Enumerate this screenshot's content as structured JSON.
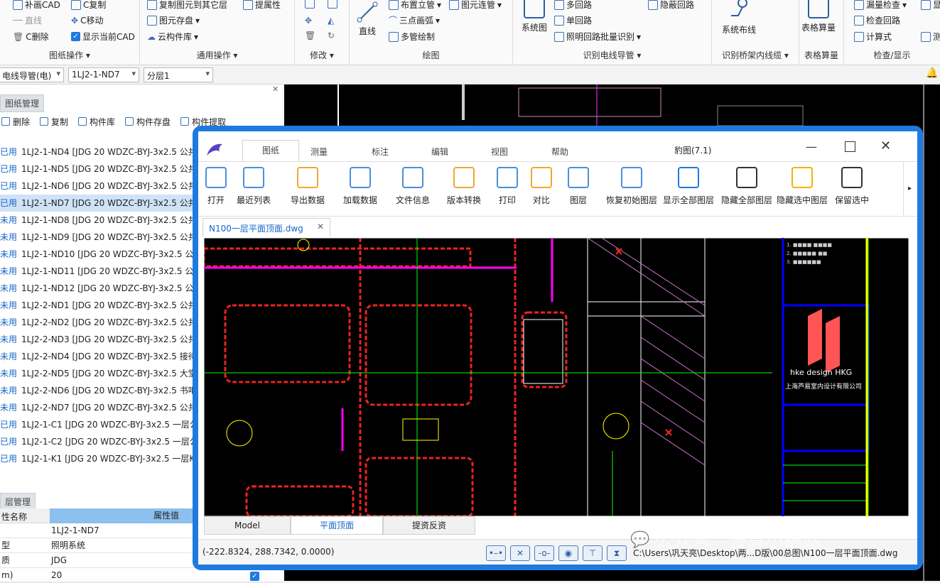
{
  "ribbon": {
    "group1": {
      "label": "图纸操作",
      "items": [
        "补画CAD",
        "C复制",
        "直线",
        "C移动",
        "C删除",
        "显示当前CAD"
      ]
    },
    "group2": {
      "label": "通用操作",
      "items": [
        "复制图元到其它层",
        "提属性",
        "图元存盘",
        "云构件库"
      ]
    },
    "group3": {
      "label": "修改"
    },
    "group4": {
      "label": "绘图",
      "items": [
        "直线",
        "布置立管",
        "图元连管",
        "三点画弧",
        "多管绘制"
      ]
    },
    "group5": {
      "label": "识别电线导管",
      "items": [
        "系统图",
        "多回路",
        "单回路",
        "隐蔽回路",
        "照明回路批量识别"
      ]
    },
    "group6": {
      "label": "识别桥架内线缆",
      "items": [
        "系统布线"
      ]
    },
    "group7": {
      "label": "表格算量",
      "items": [
        "表格算量"
      ]
    },
    "group8": {
      "label": "检查/显示",
      "items": [
        "漏量检查",
        "检查回路",
        "计算式",
        "显示",
        "测"
      ]
    }
  },
  "toolbar": {
    "combo1": "电线导管(电)",
    "combo2": "1LJ2-1-ND7",
    "combo3": "分层1"
  },
  "left_panel": {
    "tab": "图纸管理",
    "tools": [
      "删除",
      "复制",
      "构件库",
      "构件存盘",
      "构件提取"
    ],
    "rows": [
      {
        "status": "已用",
        "text": "1LJ2-1-ND4 [JDG 20 WDZC-BYJ-3x2.5 公共"
      },
      {
        "status": "已用",
        "text": "1LJ2-1-ND5 [JDG 20 WDZC-BYJ-3x2.5 公共"
      },
      {
        "status": "已用",
        "text": "1LJ2-1-ND6 [JDG 20 WDZC-BYJ-3x2.5 公共"
      },
      {
        "status": "已用",
        "text": "1LJ2-1-ND7 [JDG 20 WDZC-BYJ-3x2.5 公共"
      },
      {
        "status": "未用",
        "text": "1LJ2-1-ND8 [JDG 20 WDZC-BYJ-3x2.5 公共"
      },
      {
        "status": "未用",
        "text": "1LJ2-1-ND9 [JDG 20 WDZC-BYJ-3x2.5 公共"
      },
      {
        "status": "未用",
        "text": "1LJ2-1-ND10 [JDG 20 WDZC-BYJ-3x2.5 公"
      },
      {
        "status": "未用",
        "text": "1LJ2-1-ND11 [JDG 20 WDZC-BYJ-3x2.5 公"
      },
      {
        "status": "未用",
        "text": "1LJ2-1-ND12 [JDG 20 WDZC-BYJ-3x2.5 公"
      },
      {
        "status": "未用",
        "text": "1LJ2-2-ND1 [JDG 20 WDZC-BYJ-3x2.5 公共"
      },
      {
        "status": "未用",
        "text": "1LJ2-2-ND2 [JDG 20 WDZC-BYJ-3x2.5 公共"
      },
      {
        "status": "未用",
        "text": "1LJ2-2-ND3 [JDG 20 WDZC-BYJ-3x2.5 公共"
      },
      {
        "status": "未用",
        "text": "1LJ2-2-ND4 [JDG 20 WDZC-BYJ-3x2.5 接待"
      },
      {
        "status": "未用",
        "text": "1LJ2-2-ND5 [JDG 20 WDZC-BYJ-3x2.5 大堂"
      },
      {
        "status": "未用",
        "text": "1LJ2-2-ND6 [JDG 20 WDZC-BYJ-3x2.5 书吧"
      },
      {
        "status": "未用",
        "text": "1LJ2-2-ND7 [JDG 20 WDZC-BYJ-3x2.5 公共"
      },
      {
        "status": "已用",
        "text": "1LJ2-1-C1 [JDG 20 WDZC-BYJ-3x2.5 一层公"
      },
      {
        "status": "已用",
        "text": "1LJ2-1-C2 [JDG 20 WDZC-BYJ-3x2.5 一层公"
      },
      {
        "status": "已用",
        "text": "1LJ2-1-K1 [JDG 20 WDZC-BYJ-3x2.5 一层K"
      }
    ],
    "prop_tab": "层管理",
    "prop_header": {
      "name": "性名称",
      "value": "属性值"
    },
    "props": [
      {
        "k": "",
        "v": "1LJ2-1-ND7"
      },
      {
        "k": "型",
        "v": "照明系统"
      },
      {
        "k": "质",
        "v": "JDG"
      },
      {
        "k": "m)",
        "v": "20"
      }
    ]
  },
  "window": {
    "title": "豹图(7.1)",
    "tabs": [
      "图纸",
      "测量",
      "标注",
      "编辑",
      "视图",
      "帮助"
    ],
    "buttons": [
      "打开",
      "最近列表",
      "导出数据",
      "加载数据",
      "文件信息",
      "版本转换",
      "打印",
      "对比",
      "图层",
      "恢复初始图层",
      "显示全部图层",
      "隐藏全部图层",
      "隐藏选中图层",
      "保留选中"
    ],
    "doc_tab": "N100一层平面顶面.dwg",
    "layout_tabs": [
      "Model",
      "平面顶面",
      "提资反资"
    ],
    "coords": "(-222.8324, 288.7342, 0.0000)",
    "path": "C:\\Users\\巩天亮\\Desktop\\两...D版\\00总图\\N100一层平面顶面.dwg",
    "titleblock": {
      "brand": "hke design HKG",
      "company": "上海芦易室内设计有限公司"
    }
  },
  "watermark": "公众号 · 云算小破站",
  "colors": {
    "accent": "#1f7ae0",
    "selected_row": "#cfe2f7",
    "status_used": "#1766c9"
  }
}
